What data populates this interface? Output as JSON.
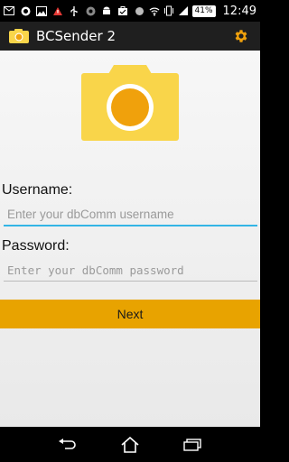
{
  "status_bar": {
    "battery": "41%",
    "time": "12:49"
  },
  "action_bar": {
    "title": "BCSender 2"
  },
  "form": {
    "username_label": "Username:",
    "username_placeholder": "Enter your dbComm username",
    "username_value": "",
    "password_label": "Password:",
    "password_placeholder": "Enter your dbComm password",
    "password_value": "",
    "next_label": "Next"
  },
  "colors": {
    "accent": "#e8a300",
    "camera_body": "#f9d54a",
    "camera_lens": "#f0a10c",
    "focus_line": "#33b5e5"
  },
  "icons": {
    "settings": "gear-icon",
    "back": "back-icon",
    "home": "home-icon",
    "recents": "recents-icon"
  }
}
